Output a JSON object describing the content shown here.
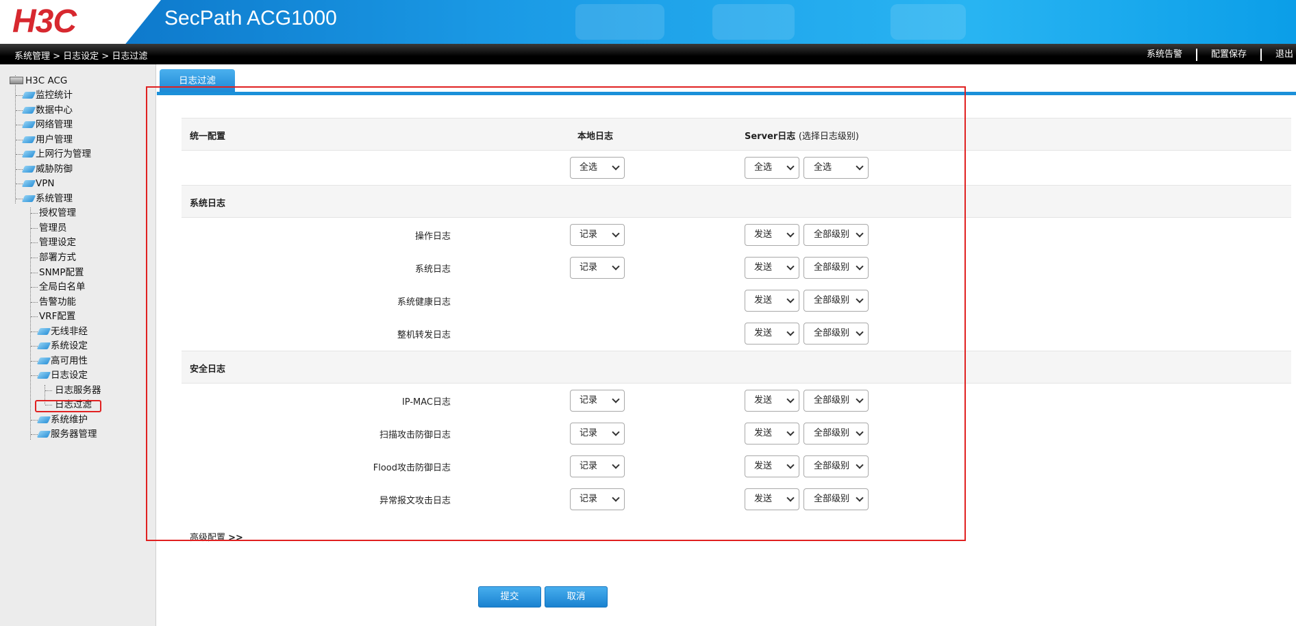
{
  "header": {
    "logo": "H3C",
    "product": "SecPath ACG1000"
  },
  "topbar": {
    "breadcrumb": "系统管理 > 日志设定 > 日志过滤",
    "actions": [
      "系统告警",
      "配置保存",
      "退出"
    ]
  },
  "sidebar": {
    "root": "H3C ACG",
    "items": [
      "监控统计",
      "数据中心",
      "网络管理",
      "用户管理",
      "上网行为管理",
      "威胁防御",
      "VPN",
      "系统管理"
    ],
    "system_children": [
      "授权管理",
      "管理员",
      "管理设定",
      "部署方式",
      "SNMP配置",
      "全局白名单",
      "告警功能",
      "VRF配置",
      "无线非经",
      "系统设定",
      "高可用性",
      "日志设定"
    ],
    "log_children": [
      "日志服务器",
      "日志过滤"
    ],
    "after_items": [
      "系统维护",
      "服务器管理"
    ]
  },
  "tab": {
    "label": "日志过滤"
  },
  "table": {
    "unified": "统一配置",
    "col_local": "本地日志",
    "col_server": "Server日志",
    "col_server_note": "(选择日志级别)",
    "select_all": "全选",
    "system_section": "系统日志",
    "security_section": "安全日志",
    "record": "记录",
    "send": "发送",
    "all_levels": "全部级别",
    "system_rows": [
      "操作日志",
      "系统日志",
      "系统健康日志",
      "整机转发日志"
    ],
    "security_rows": [
      "IP-MAC日志",
      "扫描攻击防御日志",
      "Flood攻击防御日志",
      "异常报文攻击日志"
    ]
  },
  "advanced": {
    "label": "高级配置",
    "arrows": ">>"
  },
  "buttons": {
    "submit": "提交",
    "cancel": "取消"
  }
}
